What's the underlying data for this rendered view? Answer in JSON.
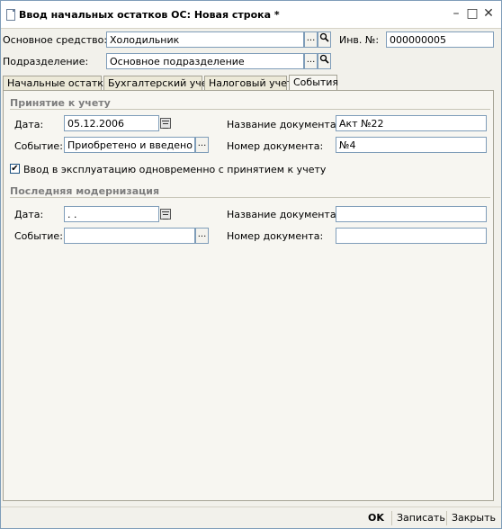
{
  "window": {
    "title": "Ввод начальных остатков ОС: Новая строка *",
    "minimize_icon": "minimize-icon",
    "maximize_icon": "maximize-icon",
    "close_icon": "close-icon"
  },
  "header": {
    "asset_label": "Основное средство:",
    "asset_value": "Холодильник",
    "inv_label": "Инв. №:",
    "inv_value": "000000005",
    "division_label": "Подразделение:",
    "division_value": "Основное подразделение",
    "select_button": "...",
    "search_icon": "magnifier-icon"
  },
  "tabs": [
    {
      "label": "Начальные остатки",
      "active": false
    },
    {
      "label": "Бухгалтерский учет",
      "active": false
    },
    {
      "label": "Налоговый учет",
      "active": false
    },
    {
      "label": "События",
      "active": true
    }
  ],
  "acceptance": {
    "section_title": "Принятие к учету",
    "date_label": "Дата:",
    "date_value": "05.12.2006",
    "event_label": "Событие:",
    "event_value": "Приобретено и введено в эк",
    "doc_name_label": "Название документа:",
    "doc_name_value": "Акт №22",
    "doc_num_label": "Номер документа:",
    "doc_num_value": "№4",
    "checkbox_label": "Ввод в эксплуатацию одновременно с принятием к учету",
    "checkbox_checked": true
  },
  "modernization": {
    "section_title": "Последняя модернизация",
    "date_label": "Дата:",
    "date_value": " .  .",
    "event_label": "Событие:",
    "event_value": "",
    "doc_name_label": "Название документа:",
    "doc_name_value": "",
    "doc_num_label": "Номер документа:",
    "doc_num_value": ""
  },
  "footer": {
    "ok": "OK",
    "save": "Записать",
    "close": "Закрыть"
  }
}
